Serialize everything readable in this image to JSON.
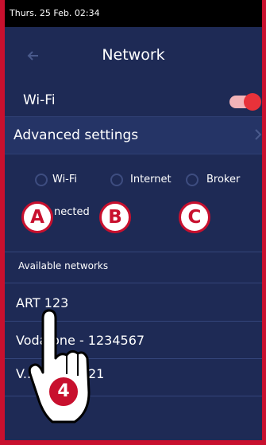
{
  "status_bar": {
    "datetime": "Thurs. 25 Feb. 02:34"
  },
  "header": {
    "title": "Network",
    "back_icon": "arrow-left-icon"
  },
  "wifi_toggle": {
    "label": "Wi-Fi",
    "enabled": true
  },
  "advanced_settings": {
    "label": "Advanced settings",
    "chevron_icon": "chevron-right-icon"
  },
  "connection_indicators": [
    {
      "label": "Wi-Fi"
    },
    {
      "label": "Internet"
    },
    {
      "label": "Broker"
    }
  ],
  "connection_status": {
    "text": "Not connected",
    "visible_text": "nected"
  },
  "available_networks": {
    "heading": "Available networks",
    "items": [
      {
        "name": "ART 123",
        "visible_name": "ART 123"
      },
      {
        "name": "Vodafone - 1234567",
        "visible_name": "Vodafone - 1234567"
      },
      {
        "name": "Vodafone - 7654321",
        "visible_name": "V... - 7654321"
      }
    ]
  },
  "callouts": {
    "a": "A",
    "b": "B",
    "c": "C",
    "step": "4"
  },
  "colors": {
    "background": "#1e2a55",
    "frame": "#c8102e",
    "toggle_on": "#e8323a",
    "text": "#ffffff"
  }
}
